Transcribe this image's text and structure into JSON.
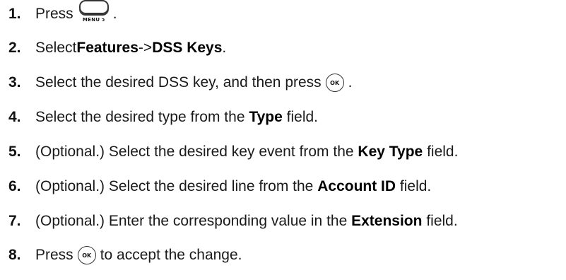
{
  "steps": [
    {
      "number": "1.",
      "parts": [
        "Press",
        "."
      ],
      "key": {
        "caption": "MENU ↄ"
      }
    },
    {
      "number": "2.",
      "parts": [
        "Select ",
        "Features",
        "->",
        "DSS Keys",
        "."
      ]
    },
    {
      "number": "3.",
      "parts": [
        "Select the desired DSS key, and then press",
        "."
      ],
      "key": {
        "label": "OK"
      }
    },
    {
      "number": "4.",
      "parts": [
        "Select the desired type from the ",
        "Type",
        " field."
      ]
    },
    {
      "number": "5.",
      "parts": [
        "(Optional.) Select the desired key event from the ",
        "Key Type",
        " field."
      ]
    },
    {
      "number": "6.",
      "parts": [
        "(Optional.) Select the desired line from the ",
        "Account ID",
        " field."
      ]
    },
    {
      "number": "7.",
      "parts": [
        "(Optional.) Enter the corresponding value in the ",
        "Extension",
        " field."
      ]
    },
    {
      "number": "8.",
      "parts": [
        "Press",
        "to accept the change."
      ],
      "key": {
        "label": "OK"
      }
    }
  ]
}
